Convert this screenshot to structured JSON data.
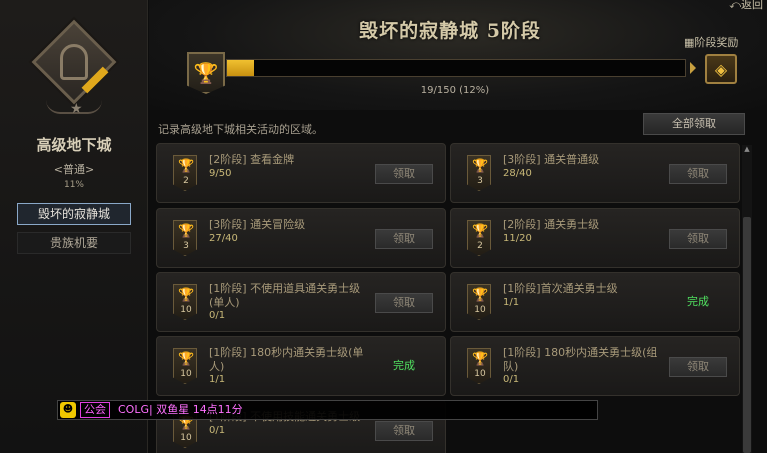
{
  "sidebar": {
    "title": "高级地下城",
    "difficulty": "<普通>",
    "percent": "11%",
    "items": [
      {
        "label": "毁坏的寂静城"
      },
      {
        "label": "贵族机要"
      }
    ]
  },
  "header": {
    "back_label": "返回",
    "title": "毁坏的寂静城 5阶段",
    "progress_text": "19/150 (12%)",
    "progress_value": 0.12,
    "stage_reward_label": "阶段奖励"
  },
  "description": "记录高级地下城相关活动的区域。",
  "claim_all_label": "全部领取",
  "cards": [
    {
      "tier": "2",
      "title": "[2阶段] 查看金牌",
      "count": "9/50",
      "action": "领取",
      "done": false
    },
    {
      "tier": "3",
      "title": "[3阶段] 通关普通级",
      "count": "28/40",
      "action": "领取",
      "done": false
    },
    {
      "tier": "3",
      "title": "[3阶段] 通关冒险级",
      "count": "27/40",
      "action": "领取",
      "done": false
    },
    {
      "tier": "2",
      "title": "[2阶段] 通关勇士级",
      "count": "11/20",
      "action": "领取",
      "done": false
    },
    {
      "tier": "10",
      "title": "[1阶段] 不使用道具通关勇士级(单人)",
      "count": "0/1",
      "action": "领取",
      "done": false
    },
    {
      "tier": "10",
      "title": "[1阶段]首次通关勇士级",
      "count": "1/1",
      "action": "完成",
      "done": true
    },
    {
      "tier": "10",
      "title": "[1阶段] 180秒内通关勇士级(单人)",
      "count": "1/1",
      "action": "完成",
      "done": true
    },
    {
      "tier": "10",
      "title": "[1阶段] 180秒内通关勇士级(组队)",
      "count": "0/1",
      "action": "领取",
      "done": false
    },
    {
      "tier": "10",
      "title": "[1阶段] 不使用技能通关勇士级",
      "count": "0/1",
      "action": "领取",
      "done": false
    }
  ],
  "chat": {
    "channel": "公会",
    "message": "COLG| 双鱼星 14点11分"
  },
  "colors": {
    "accent": "#e0a820",
    "done": "#50e060",
    "chat": "#ff60ff"
  }
}
